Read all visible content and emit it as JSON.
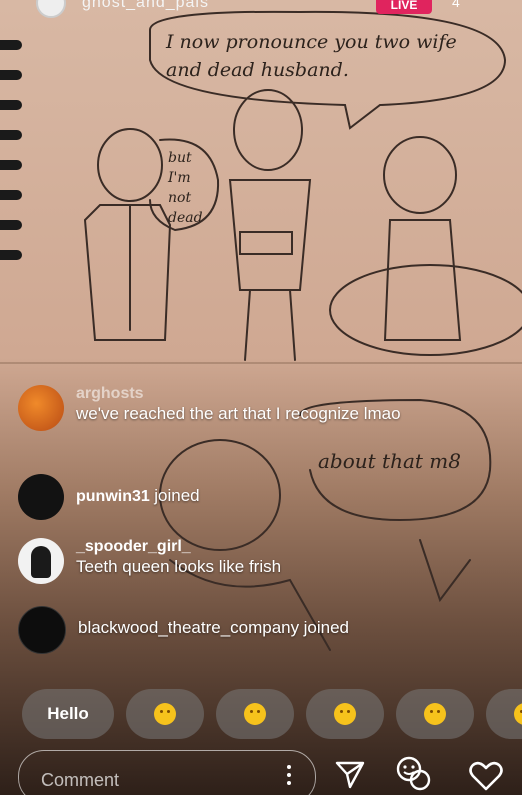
{
  "top_bar": {
    "username": "ghost_and_pals",
    "live_label": "LIVE",
    "viewers": "4"
  },
  "drawing": {
    "speech_top": "I now pronounce you two wife and dead husband.",
    "speech_left": "but I'm not dead",
    "speech_lower": "about that m8"
  },
  "comments": [
    {
      "username": "arghosts",
      "text": "we've reached the art that I recognize lmao",
      "type": "comment"
    },
    {
      "username": "punwin31",
      "text": "joined",
      "type": "join"
    },
    {
      "username": "_spooder_girl_",
      "text": "Teeth queen looks like frish",
      "type": "comment"
    },
    {
      "username": "blackwood_theatre_company",
      "text": "joined",
      "type": "join"
    }
  ],
  "reactions": [
    {
      "label": "Hello",
      "kind": "text"
    },
    {
      "icon": "smiling-face-icon",
      "kind": "emoji"
    },
    {
      "icon": "heart-eyes-face-icon",
      "kind": "emoji"
    },
    {
      "icon": "clapping-hands-icon",
      "kind": "emoji"
    },
    {
      "icon": "thumbs-up-icon",
      "kind": "emoji"
    },
    {
      "icon": "laughing-face-icon",
      "kind": "emoji"
    }
  ],
  "bottom_bar": {
    "comment_placeholder": "Comment"
  },
  "colors": {
    "live": "#e0245e",
    "emoji": "#f6c21c"
  }
}
